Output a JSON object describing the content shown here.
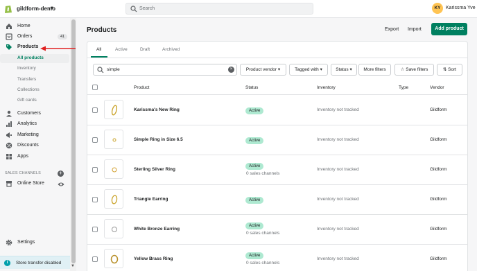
{
  "topbar": {
    "store_name": "gildform-demo",
    "search_placeholder": "Search",
    "avatar_initials": "KY",
    "user_name": "Karissma Yve"
  },
  "sidebar": {
    "items": [
      {
        "label": "Home",
        "icon": "home-icon"
      },
      {
        "label": "Orders",
        "icon": "orders-icon",
        "badge": "41"
      },
      {
        "label": "Products",
        "icon": "tag-icon",
        "active": true
      }
    ],
    "product_subitems": [
      "All products",
      "Inventory",
      "Transfers",
      "Collections",
      "Gift cards"
    ],
    "items_lower": [
      {
        "label": "Customers",
        "icon": "person-icon"
      },
      {
        "label": "Analytics",
        "icon": "analytics-icon"
      },
      {
        "label": "Marketing",
        "icon": "marketing-icon"
      },
      {
        "label": "Discounts",
        "icon": "discount-icon"
      },
      {
        "label": "Apps",
        "icon": "apps-icon"
      }
    ],
    "sales_channels_label": "SALES CHANNELS",
    "online_store_label": "Online Store",
    "settings_label": "Settings",
    "toast_label": "Store transfer disabled",
    "accent_color": "#008060",
    "arrow_color": "#e02020"
  },
  "page": {
    "title": "Products",
    "export_label": "Export",
    "import_label": "Import",
    "add_product_label": "Add product"
  },
  "tabs": [
    "All",
    "Active",
    "Draft",
    "Archived"
  ],
  "filters": {
    "search_value": "simple",
    "vendor_label": "Product vendor",
    "tagged_label": "Tagged with",
    "status_label": "Status",
    "more_label": "More filters",
    "save_label": "Save filters",
    "sort_label": "Sort"
  },
  "table": {
    "headers": {
      "product": "Product",
      "status": "Status",
      "inventory": "Inventory",
      "type": "Type",
      "vendor": "Vendor"
    },
    "rows": [
      {
        "name": "Karissma's New Ring",
        "status": "Active",
        "channels": "",
        "inventory": "Inventory not tracked",
        "vendor": "Gildform"
      },
      {
        "name": "Simple Ring in Size 6.5",
        "status": "Active",
        "channels": "",
        "inventory": "Inventory not tracked",
        "vendor": "Gildform"
      },
      {
        "name": "Sterling Silver Ring",
        "status": "Active",
        "channels": "0 sales channels",
        "inventory": "Inventory not tracked",
        "vendor": "Gildform"
      },
      {
        "name": "Triangle Earring",
        "status": "Active",
        "channels": "",
        "inventory": "Inventory not tracked",
        "vendor": "Gildform"
      },
      {
        "name": "White Bronze Earring",
        "status": "Active",
        "channels": "0 sales channels",
        "inventory": "Inventory not tracked",
        "vendor": "Gildform"
      },
      {
        "name": "Yellow Brass Ring",
        "status": "Active",
        "channels": "0 sales channels",
        "inventory": "Inventory not tracked",
        "vendor": "Gildform"
      }
    ]
  }
}
